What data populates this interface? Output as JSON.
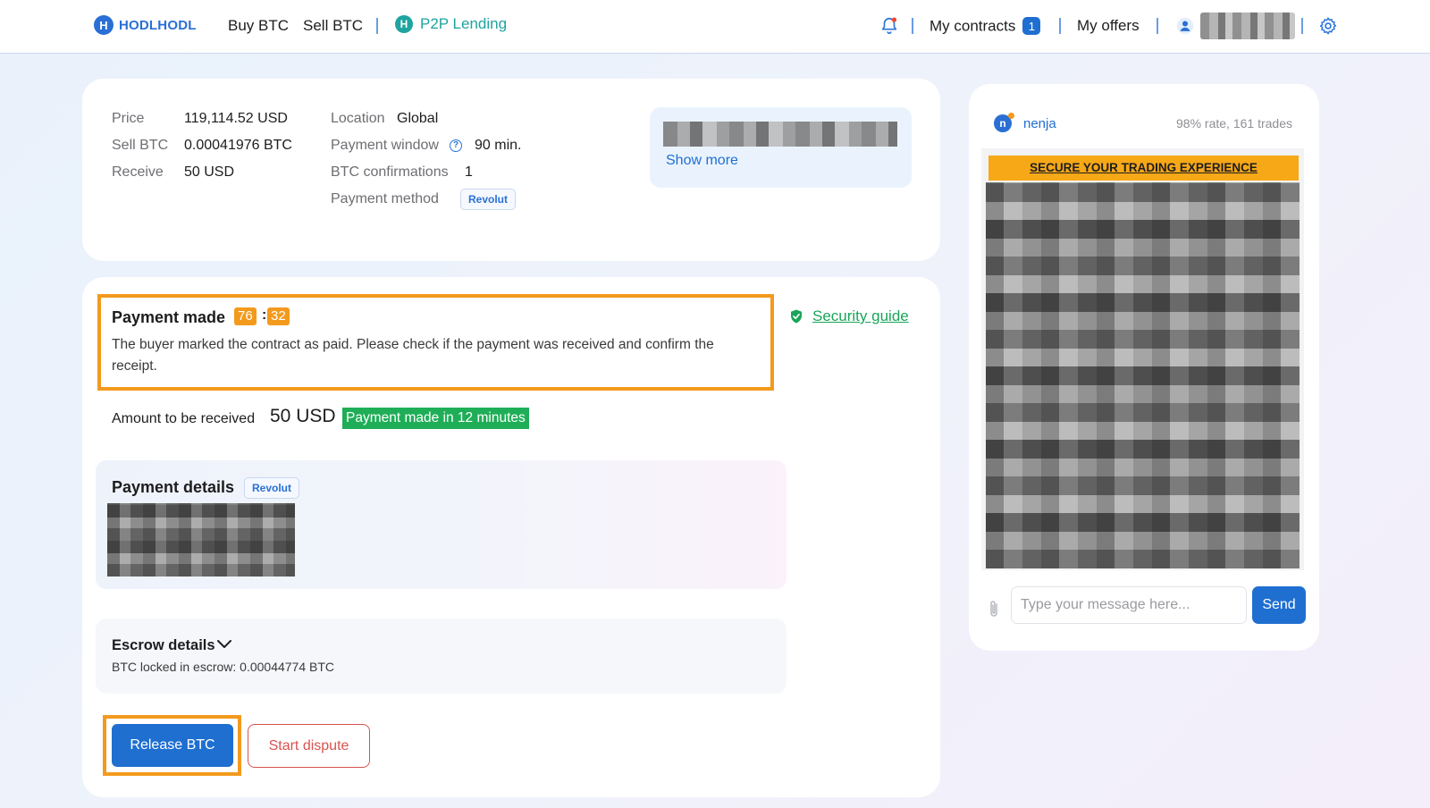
{
  "header": {
    "logo_text": "HODLHODL",
    "nav": {
      "buy": "Buy BTC",
      "sell": "Sell BTC",
      "lending": "P2P Lending"
    },
    "contracts_label": "My contracts",
    "contracts_count": "1",
    "offers_label": "My offers"
  },
  "offer": {
    "price_label": "Price",
    "price_value": "119,114.52 USD",
    "sell_label": "Sell BTC",
    "sell_value": "0.00041976 BTC",
    "receive_label": "Receive",
    "receive_value": "50 USD",
    "location_label": "Location",
    "location_value": "Global",
    "window_label": "Payment window",
    "window_value": "90 min.",
    "confirmations_label": "BTC confirmations",
    "confirmations_value": "1",
    "method_label": "Payment method",
    "method_value": "Revolut",
    "show_more": "Show more"
  },
  "status": {
    "title": "Payment made",
    "timer_minutes": "76",
    "timer_seconds": "32",
    "text": "The buyer marked the contract as paid. Please check if the payment was received and confirm the receipt.",
    "security_link": "Security guide"
  },
  "amount": {
    "label": "Amount to be received",
    "value": "50 USD",
    "badge": "Payment made in 12 minutes"
  },
  "payment_details": {
    "title": "Payment details",
    "method": "Revolut"
  },
  "escrow": {
    "title": "Escrow details",
    "locked": "BTC locked in escrow: 0.00044774 BTC"
  },
  "actions": {
    "release": "Release BTC",
    "dispute": "Start dispute"
  },
  "chat": {
    "avatar_letter": "n",
    "name": "nenja",
    "stats": "98% rate, 161 trades",
    "banner": "SECURE YOUR TRADING EXPERIENCE",
    "placeholder": "Type your message here...",
    "send": "Send"
  },
  "colors": {
    "accent": "#1f6fd1",
    "highlight": "#f39a1d",
    "success": "#1fae57",
    "danger": "#d9534f",
    "lending": "#1fa4a0"
  },
  "icons": [
    "bell-icon",
    "user-icon",
    "gear-icon",
    "help-icon",
    "shield-check-icon",
    "chevron-down-icon",
    "paperclip-icon"
  ]
}
